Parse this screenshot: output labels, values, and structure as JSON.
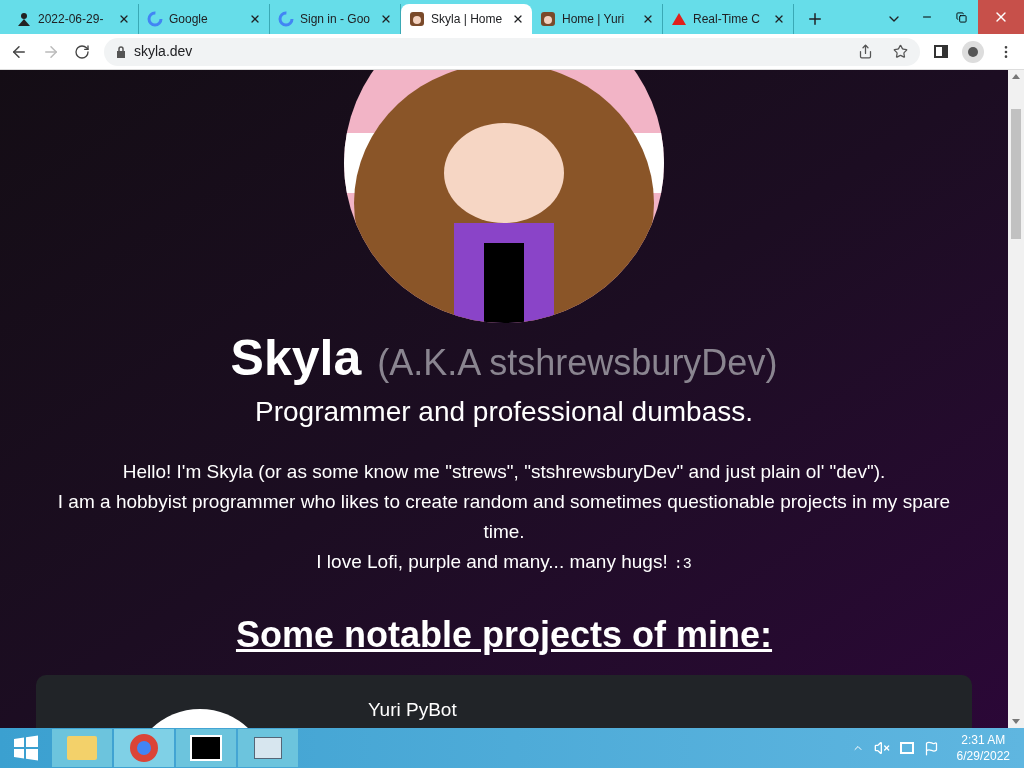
{
  "tabs": [
    {
      "title": "2022-06-29-",
      "selected": false,
      "kind": "person"
    },
    {
      "title": "Google",
      "selected": false,
      "kind": "google"
    },
    {
      "title": "Sign in - Goo",
      "selected": false,
      "kind": "google"
    },
    {
      "title": "Skyla | Home",
      "selected": true,
      "kind": "avatar"
    },
    {
      "title": "Home | Yuri",
      "selected": false,
      "kind": "avatar"
    },
    {
      "title": "Real-Time C",
      "selected": false,
      "kind": "triangle"
    }
  ],
  "address": "skyla.dev",
  "profile": {
    "name": "Skyla",
    "alias": "(A.K.A stshrewsburyDev)",
    "tagline": "Programmer and professional dumbass."
  },
  "intro_lines": [
    "Hello! I'm Skyla (or as some know me \"strews\", \"stshrewsburyDev\" and just plain ol' \"dev\").",
    "I am a hobbyist programmer who likes to create random and sometimes questionable projects in my spare time."
  ],
  "last_line": {
    "text": "I love Lofi, purple and many... many hugs!",
    "emoticon": ":3"
  },
  "projects_heading": "Some notable projects of mine:",
  "projects": [
    {
      "name": "Yuri PyBot"
    }
  ],
  "taskbar": {
    "time": "2:31 AM",
    "date": "6/29/2022"
  }
}
